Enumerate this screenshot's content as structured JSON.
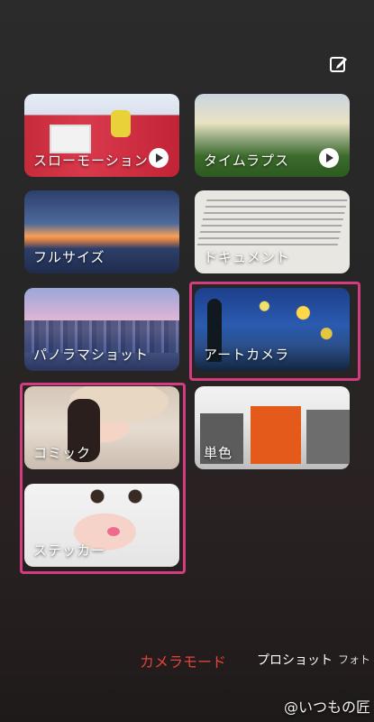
{
  "header": {
    "edit_icon": "edit-icon"
  },
  "tiles": [
    {
      "label": "スローモーション",
      "has_play": true
    },
    {
      "label": "タイムラプス",
      "has_play": true
    },
    {
      "label": "フルサイズ",
      "has_play": false
    },
    {
      "label": "ドキュメント",
      "has_play": false
    },
    {
      "label": "パノラマショット",
      "has_play": false
    },
    {
      "label": "アートカメラ",
      "has_play": false
    },
    {
      "label": "コミック",
      "has_play": false
    },
    {
      "label": "単色",
      "has_play": false
    },
    {
      "label": "ステッカー",
      "has_play": false
    }
  ],
  "highlight_color": "#d33c7f",
  "mode_bar": {
    "active": "カメラモード",
    "items": [
      "カメラモード",
      "プロショット",
      "フォト"
    ],
    "active_color": "#e0433c"
  },
  "watermark": "@いつもの匠"
}
